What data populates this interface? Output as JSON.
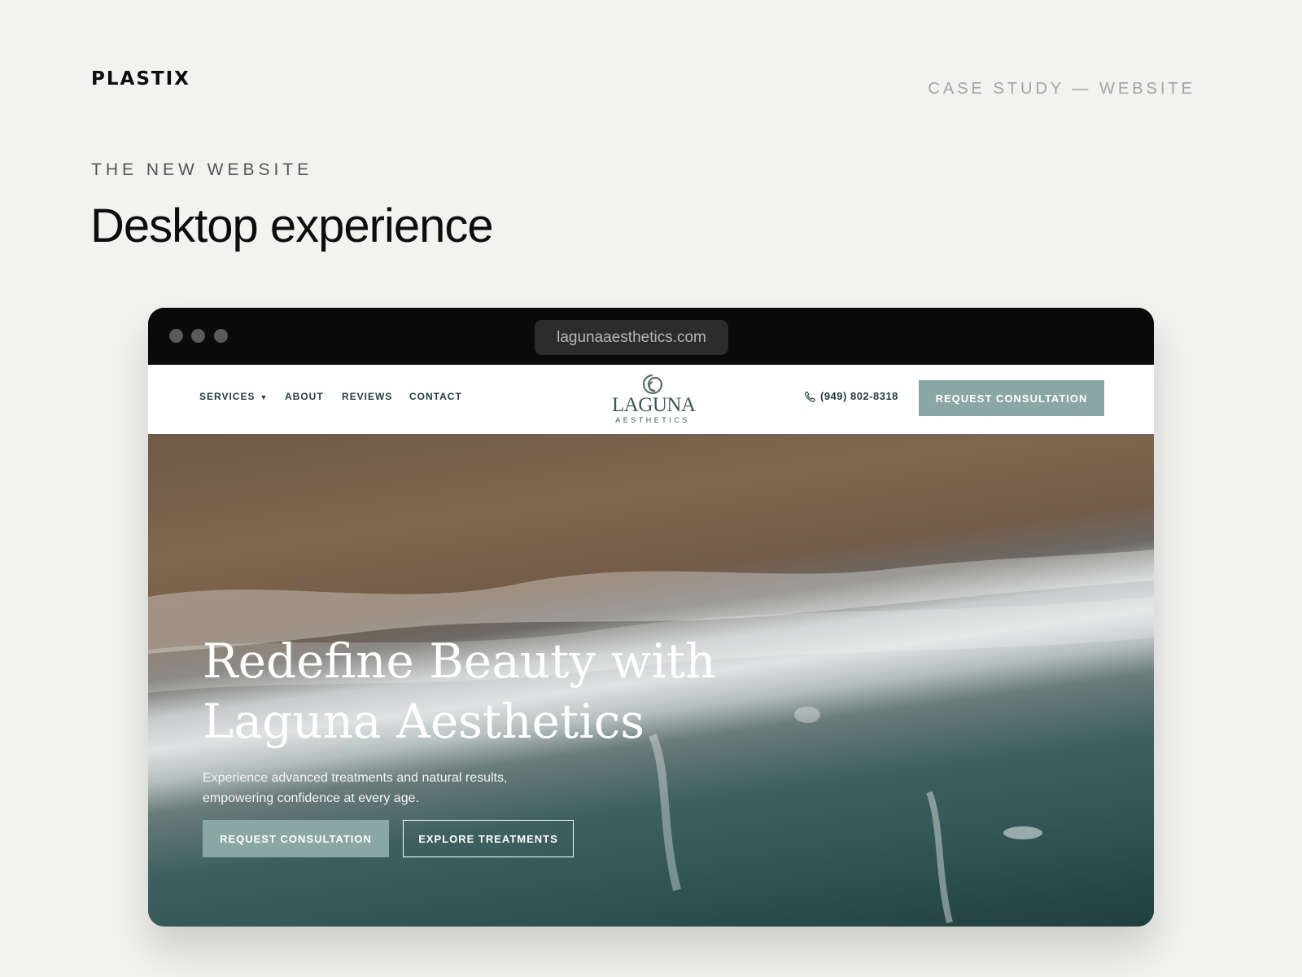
{
  "brand": {
    "name": "PLASTIX"
  },
  "header": {
    "case_label": "CASE STUDY — WEBSITE"
  },
  "section": {
    "eyebrow": "THE NEW WEBSITE",
    "title": "Desktop experience"
  },
  "browser": {
    "url": "lagunaaesthetics.com"
  },
  "site": {
    "nav": {
      "services": "SERVICES",
      "about": "ABOUT",
      "reviews": "REVIEWS",
      "contact": "CONTACT"
    },
    "logo": {
      "word": "LAGUNA",
      "sub": "AESTHETICS"
    },
    "phone": "(949) 802-8318",
    "nav_cta": "REQUEST CONSULTATION",
    "hero": {
      "title_line1": "Redefine Beauty with",
      "title_line2": "Laguna Aesthetics",
      "subtitle": "Experience advanced treatments and natural results, empowering confidence at every age.",
      "primary_cta": "REQUEST CONSULTATION",
      "secondary_cta": "EXPLORE TREATMENTS"
    }
  },
  "colors": {
    "page_bg": "#f2f2f0",
    "browser_chrome": "#0a0a0a",
    "accent_sage": "#8aa7a3",
    "nav_text": "#253b3a"
  },
  "icons": {
    "window_controls": "traffic-light-dots",
    "services_dropdown": "chevron-down-icon",
    "phone": "phone-icon",
    "logo_mark": "spiral-icon"
  }
}
